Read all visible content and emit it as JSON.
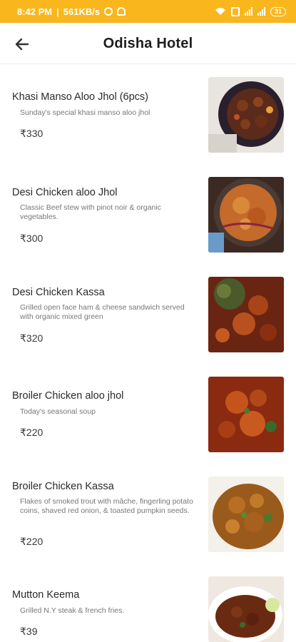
{
  "status_bar": {
    "time": "8:42 PM",
    "network_speed": "561KB/s",
    "battery": "31"
  },
  "header": {
    "title": "Odisha Hotel",
    "back_icon": "arrow-left-icon"
  },
  "menu": {
    "items": [
      {
        "name": "Khasi Manso Aloo Jhol (6pcs)",
        "description": "Sunday's special khasi manso aloo jhol",
        "price": "₹330",
        "photo": "dish-photo-mutton-curry"
      },
      {
        "name": "Desi Chicken aloo Jhol",
        "description": "Classic Beef stew with pinot noir & organic vegetables.",
        "price": "₹300",
        "photo": "dish-photo-chicken-jhol"
      },
      {
        "name": "Desi Chicken Kassa",
        "description": "Grilled open face ham & cheese sandwich served with organic mixed green",
        "price": "₹320",
        "photo": "dish-photo-chicken-kassa"
      },
      {
        "name": "Broiler Chicken aloo jhol",
        "description": "Today's seasonal soup",
        "price": "₹220",
        "photo": "dish-photo-broiler-jhol"
      },
      {
        "name": "Broiler Chicken Kassa",
        "description": "Flakes of smoked trout with mâche, fingerling potato coins, shaved red onion, & toasted pumpkin seeds.",
        "price": "₹220",
        "photo": "dish-photo-broiler-kassa"
      },
      {
        "name": "Mutton Keema",
        "description": "Grilled N.Y steak & french fries.",
        "price": "₹39",
        "photo": "dish-photo-mutton-keema"
      }
    ]
  },
  "colors": {
    "status_bar": "#f9b71d",
    "title_text": "#1e1e1e",
    "description_text": "#777777"
  }
}
